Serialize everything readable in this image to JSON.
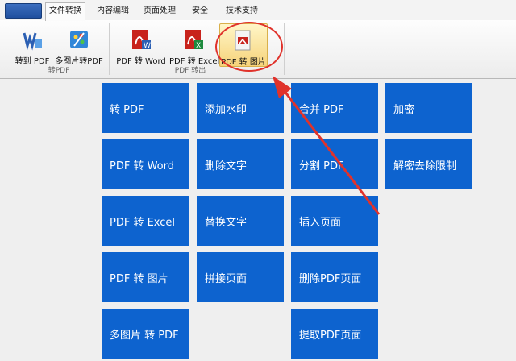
{
  "tabs": [
    "文件转换",
    "内容编辑",
    "页面处理",
    "安全",
    "技术支持"
  ],
  "ribbon": {
    "groups": [
      {
        "label": "转PDF",
        "buttons": [
          "转到 PDF",
          "多图片转PDF"
        ]
      },
      {
        "label": "PDF 转出",
        "buttons": [
          "PDF 转 Word",
          "PDF 转 Excel",
          "PDF 转 图片"
        ]
      }
    ]
  },
  "tiles": [
    [
      "转 PDF",
      "PDF 转 Word",
      "PDF 转 Excel",
      "PDF 转 图片",
      "多图片 转 PDF"
    ],
    [
      "添加水印",
      "删除文字",
      "替换文字",
      "拼接页面"
    ],
    [
      "合并 PDF",
      "分割 PDF",
      "插入页面",
      "删除PDF页面",
      "提取PDF页面"
    ],
    [
      "加密",
      "解密去除限制"
    ]
  ],
  "colors": {
    "tile": "#0d63cf",
    "highlight": "#e0322b"
  }
}
